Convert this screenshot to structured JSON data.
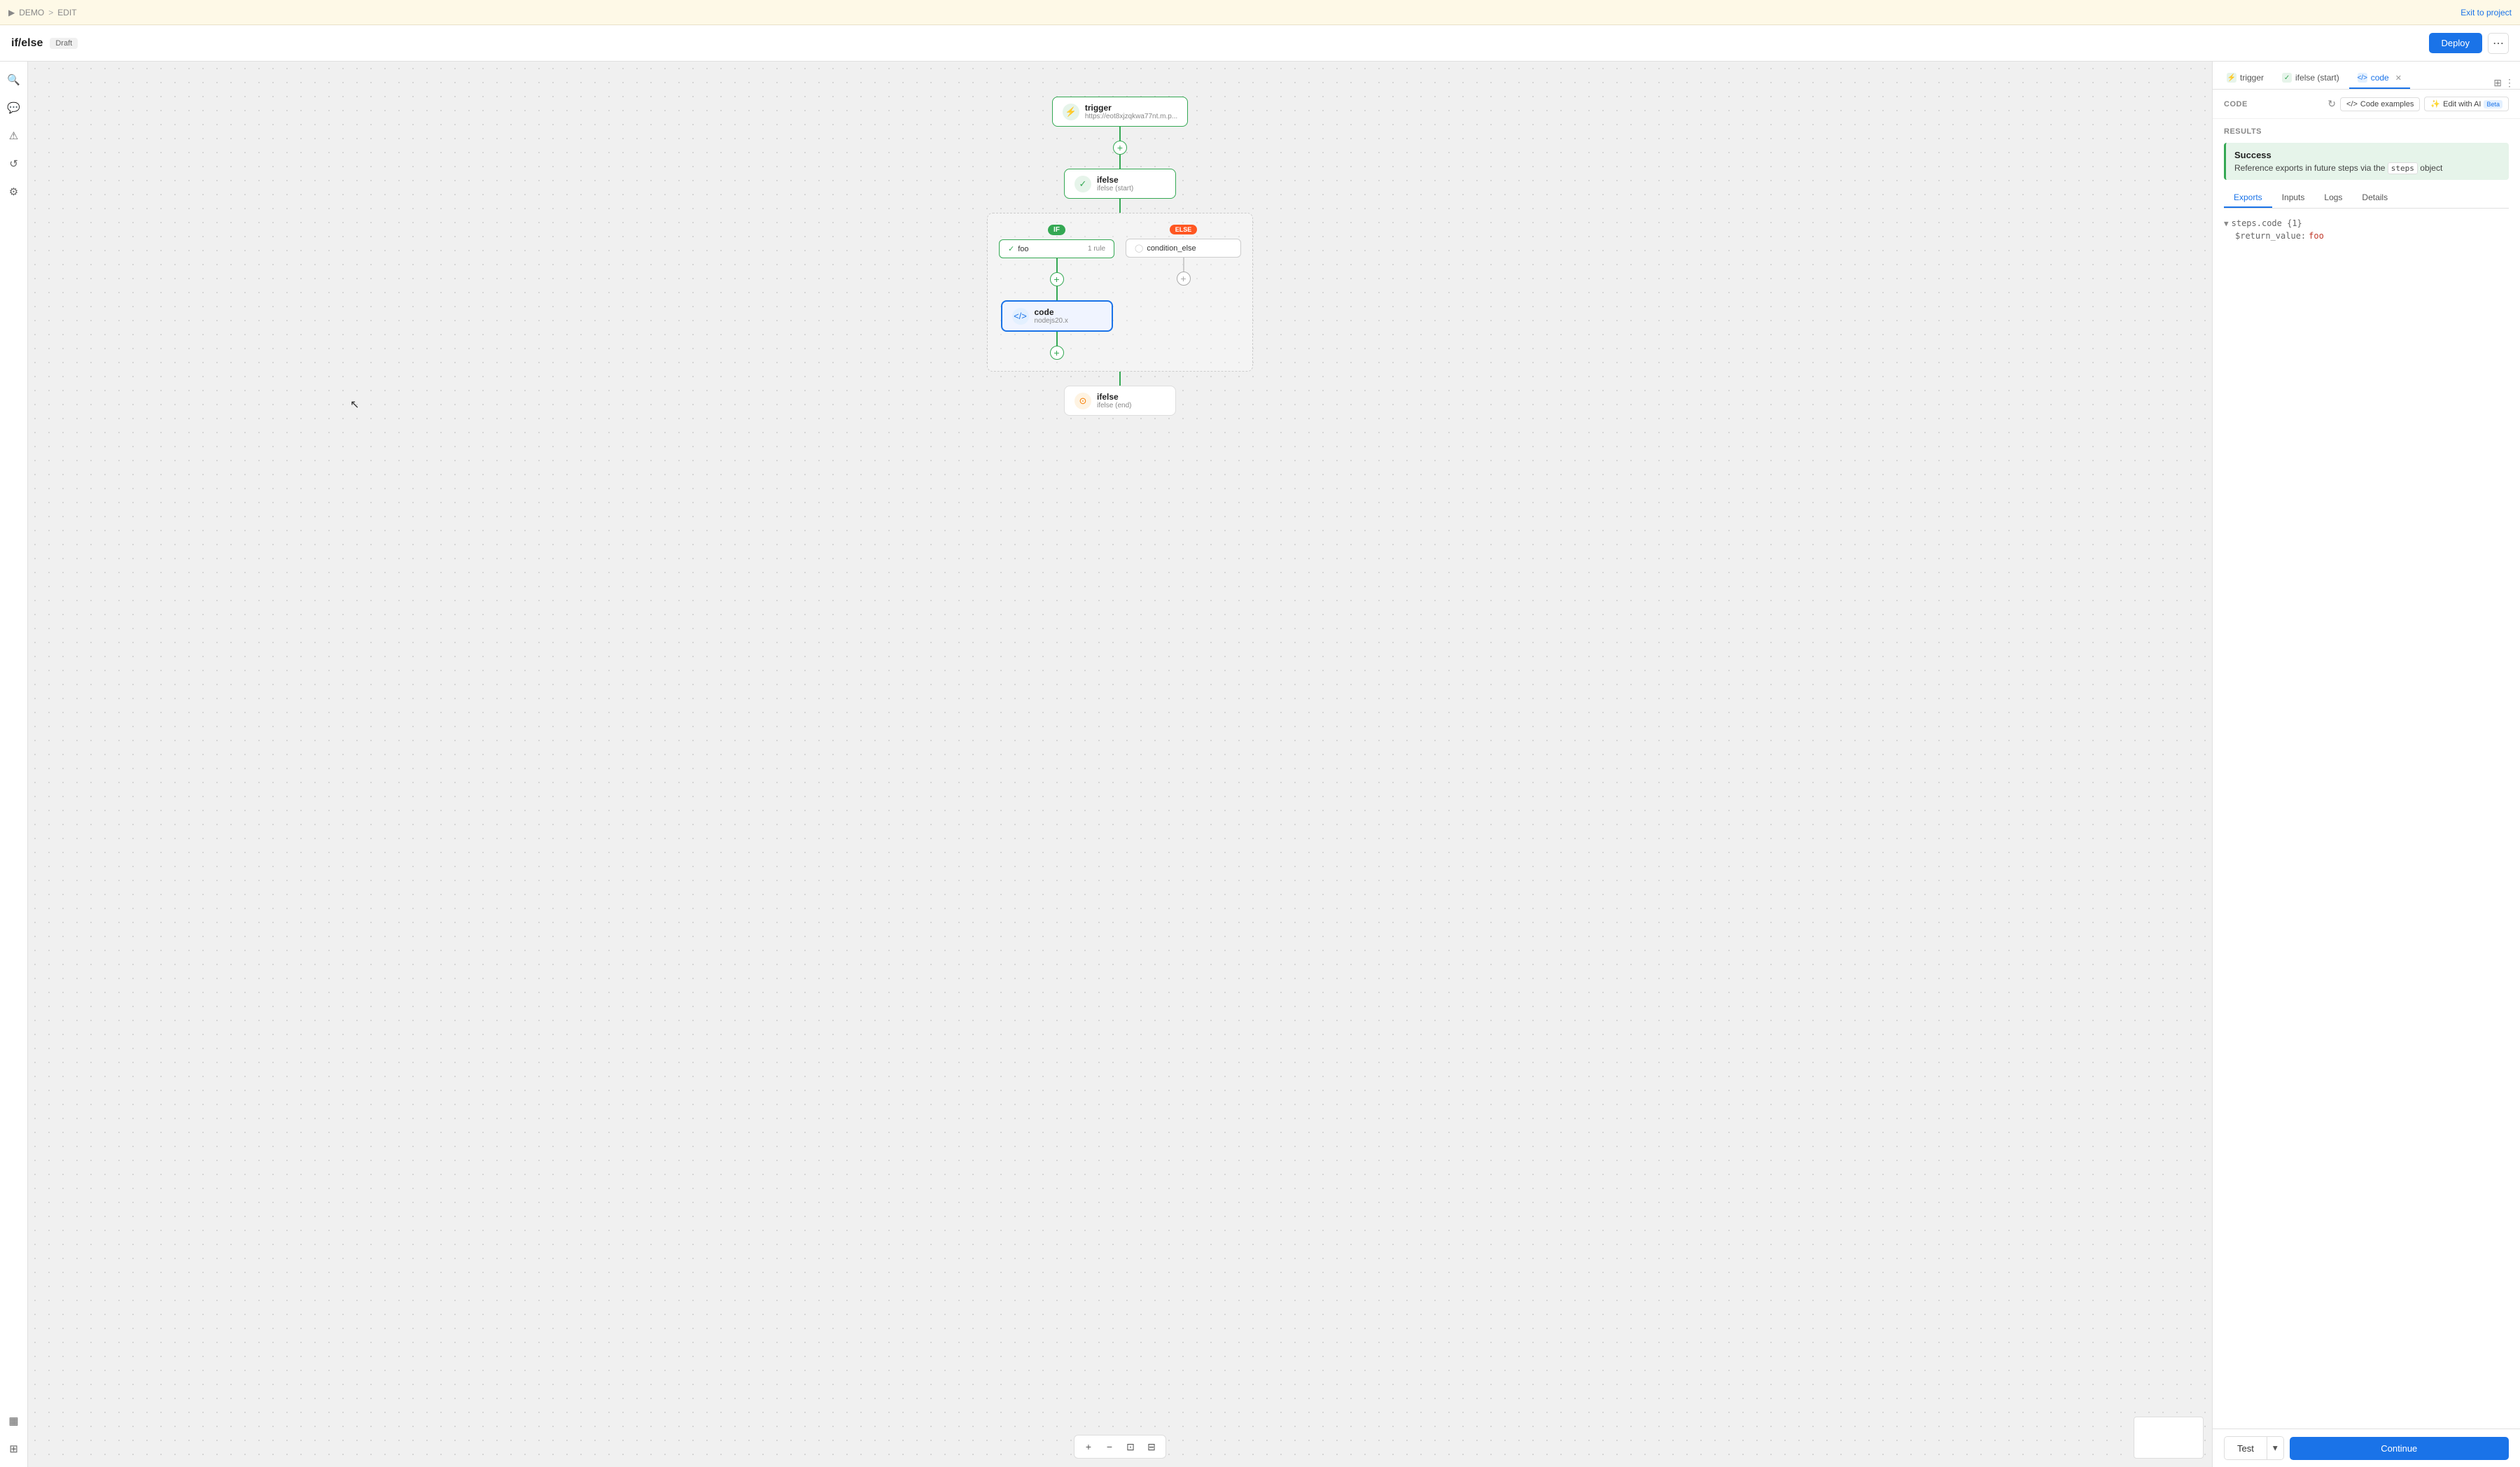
{
  "topbar": {
    "breadcrumb": [
      "▶",
      "DEMO",
      ">",
      "EDIT"
    ],
    "demo_label": "DEMO",
    "edit_label": "EDIT",
    "exit_link": "Exit to project"
  },
  "header": {
    "title": "if/else",
    "badge": "Draft",
    "deploy_btn": "Deploy"
  },
  "sidebar": {
    "icons": [
      {
        "name": "search-icon",
        "glyph": "🔍"
      },
      {
        "name": "comment-icon",
        "glyph": "💬"
      },
      {
        "name": "alert-icon",
        "glyph": "⚠"
      },
      {
        "name": "history-icon",
        "glyph": "↺"
      },
      {
        "name": "settings-icon",
        "glyph": "⚙"
      },
      {
        "name": "layers-icon",
        "glyph": "▦"
      },
      {
        "name": "grid-icon",
        "glyph": "⊞"
      }
    ]
  },
  "flow": {
    "trigger_node": {
      "name": "trigger",
      "sub": "https://eot8xjzqkwa77nt.m.p..."
    },
    "ifelse_start_node": {
      "name": "ifelse",
      "sub": "ifelse (start)"
    },
    "if_branch_label": "IF",
    "else_branch_label": "ELSE",
    "foo_condition": {
      "name": "foo",
      "badge": "1 rule"
    },
    "else_condition": {
      "name": "condition_else"
    },
    "code_node": {
      "name": "code",
      "sub": "nodejs20.x"
    },
    "ifelse_end_node": {
      "name": "ifelse",
      "sub": "ifelse (end)"
    }
  },
  "right_panel": {
    "tabs": [
      {
        "id": "trigger",
        "label": "trigger",
        "active": false
      },
      {
        "id": "ifelse-start",
        "label": "ifelse (start)",
        "active": false
      },
      {
        "id": "code",
        "label": "code",
        "active": true,
        "closeable": true
      }
    ],
    "code_section_label": "CODE",
    "refresh_btn": "↻",
    "code_examples_btn": "Code examples",
    "edit_ai_btn": "Edit with AI",
    "beta_badge": "Beta",
    "results_section_label": "RESULTS",
    "success": {
      "title": "Success",
      "text": "Reference exports in future steps via the",
      "code": "steps",
      "text2": "object"
    },
    "result_tabs": [
      "Exports",
      "Inputs",
      "Logs",
      "Details"
    ],
    "exports": {
      "path": "▼ steps.code {1}",
      "return_value_key": "$return_value:",
      "return_value_val": "foo"
    },
    "test_btn": "Test",
    "continue_btn": "Continue"
  },
  "canvas_toolbar": {
    "add": "+",
    "subtract": "−",
    "fit": "⊡",
    "layout": "⊟"
  }
}
